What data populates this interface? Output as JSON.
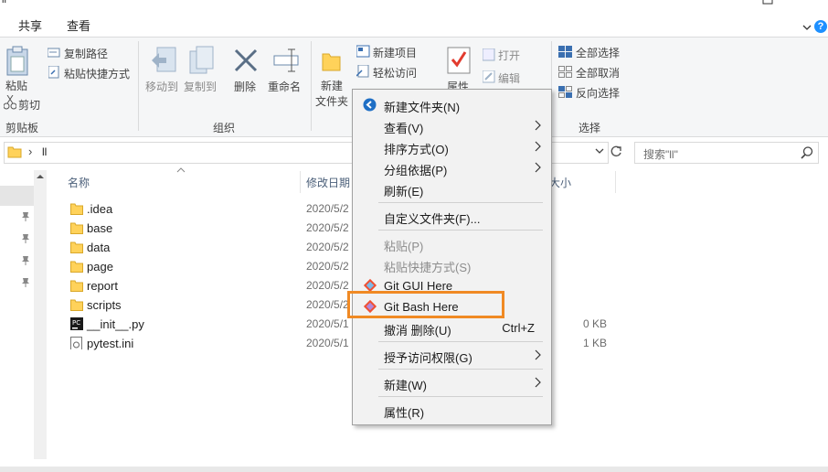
{
  "window": {
    "title_fragment": "ll",
    "minimize": "—",
    "maximize": "☐",
    "help_icon": "?"
  },
  "ribbon": {
    "tabs": [
      "共享",
      "查看"
    ],
    "clipboard": {
      "paste": "粘贴",
      "copy_path": "复制路径",
      "paste_shortcut": "粘贴快捷方式",
      "cut": "剪切",
      "group": "剪贴板"
    },
    "organize": {
      "move_to": "移动到",
      "copy_to": "复制到",
      "delete": "删除",
      "rename": "重命名",
      "group": "组织"
    },
    "new": {
      "new_folder": "新建",
      "new_folder2": "文件夹",
      "new_item": "新建项目",
      "easy_access": "轻松访问"
    },
    "open": {
      "properties": "属性",
      "open": "打开",
      "edit": "编辑"
    },
    "select": {
      "select_all": "全部选择",
      "select_none": "全部取消",
      "invert": "反向选择",
      "group": "选择"
    }
  },
  "address": {
    "path_sep": "›",
    "path": "ll",
    "search_placeholder": "搜索\"ll\""
  },
  "columns": {
    "name": "名称",
    "modified": "修改日期",
    "size": "大小"
  },
  "files": [
    {
      "name": ".idea",
      "date": "2020/5/2",
      "size": "",
      "type": "folder"
    },
    {
      "name": "base",
      "date": "2020/5/2",
      "size": "",
      "type": "folder"
    },
    {
      "name": "data",
      "date": "2020/5/2",
      "size": "",
      "type": "folder"
    },
    {
      "name": "page",
      "date": "2020/5/2",
      "size": "",
      "type": "folder"
    },
    {
      "name": "report",
      "date": "2020/5/2",
      "size": "",
      "type": "folder"
    },
    {
      "name": "scripts",
      "date": "2020/5/2",
      "size": "",
      "type": "folder"
    },
    {
      "name": "__init__.py",
      "date": "2020/5/1",
      "size": "0 KB",
      "type": "py"
    },
    {
      "name": "pytest.ini",
      "date": "2020/5/1",
      "size": "1 KB",
      "type": "ini"
    }
  ],
  "context_menu": {
    "new_folder": "新建文件夹(N)",
    "view": "查看(V)",
    "sort": "排序方式(O)",
    "group": "分组依据(P)",
    "refresh": "刷新(E)",
    "customize": "自定义文件夹(F)...",
    "paste": "粘贴(P)",
    "paste_shortcut": "粘贴快捷方式(S)",
    "git_gui": "Git GUI Here",
    "git_bash": "Git Bash Here",
    "undo_delete": "撤消 删除(U)",
    "undo_shortcut": "Ctrl+Z",
    "grant_access": "授予访问权限(G)",
    "new": "新建(W)",
    "properties": "属性(R)"
  },
  "colors": {
    "highlight": "#f08a24",
    "accent": "#0078d7",
    "folder": "#ffd25a"
  }
}
